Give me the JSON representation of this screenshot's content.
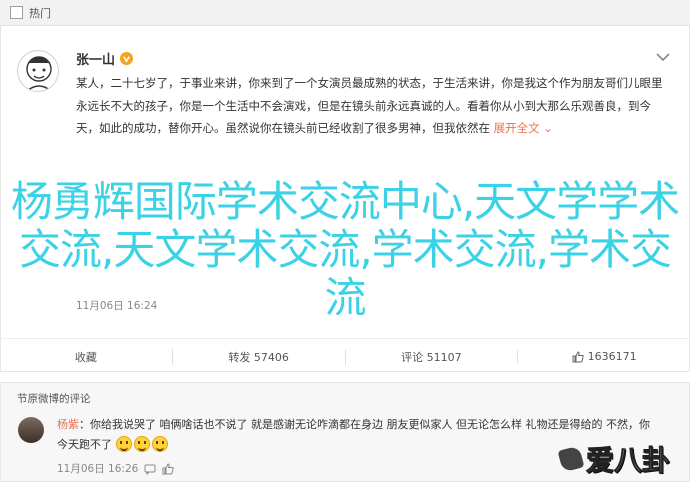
{
  "topbar": {
    "label": "热门"
  },
  "post": {
    "username": "张一山",
    "text_main": "某人，二十七岁了，于事业来讲，你来到了一个女演员最成熟的状态，于生活来讲，你是我这个作为朋友哥们儿眼里永远长不大的孩子，你是一个生活中不会演戏，但是在镜头前永远真诚的人。看着你从小到大那么乐观善良，到今天，如此的成功，替你开心。虽然说你在镜头前已经收割了很多男神，但我依然在",
    "text_link": "展开全文",
    "overlay_text": "杨勇辉国际学术交流中心,天文学学术交流,天文学术交流,学术交流,学术交流",
    "date": "11月06日 16:24"
  },
  "actions": {
    "favorite": "收藏",
    "repost": "转发 57406",
    "comment": "评论 51107",
    "like": "1636171"
  },
  "comment": {
    "source": "节原微博的评论",
    "author": "杨紫",
    "text": "：你给我说哭了 咱俩啥话也不说了 就是感谢无论咋滴都在身边 朋友更似家人 但无论怎么样 礼物还是得给的 不然，你今天跑不了",
    "date": "11月06日 16:26"
  },
  "watermark": {
    "text": "爱八卦"
  },
  "colors": {
    "link": "#eb7350",
    "overlay": "#3cd2e6",
    "vbadge": "#f2a520"
  }
}
